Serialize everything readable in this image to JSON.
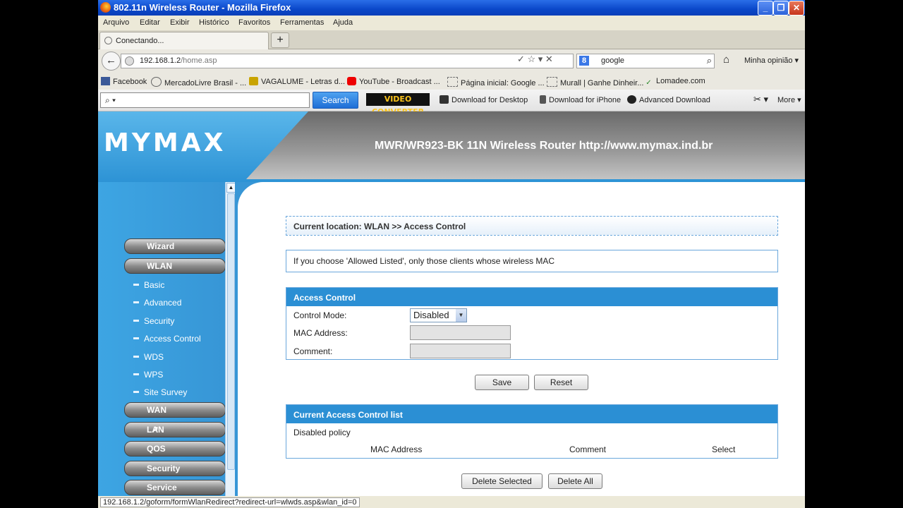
{
  "window": {
    "title": "802.11n Wireless Router - Mozilla Firefox",
    "min": "_",
    "max": "❐",
    "close": "✕"
  },
  "menubar": [
    "Arquivo",
    "Editar",
    "Exibir",
    "Histórico",
    "Favoritos",
    "Ferramentas",
    "Ajuda"
  ],
  "tabs": [
    {
      "label": "Conectando..."
    }
  ],
  "newtab": "+",
  "nav": {
    "back": "←",
    "url_host": "192.168.1.2",
    "url_path": "/home.asp",
    "search_engine": "8",
    "search_value": "google",
    "home": "⌂",
    "opinion": "Minha opinião ▾",
    "url_icons": "✓ ☆ ▾ ✕"
  },
  "bookmarks": [
    "Facebook",
    "MercadoLivre Brasil - ...",
    "VAGALUME - Letras d...",
    "YouTube - Broadcast ...",
    "Página inicial: Google ...",
    "Murall | Ganhe Dinheir...",
    "Lomadee.com"
  ],
  "search_toolbar": {
    "placeholder": "⌕ ▾",
    "search_button": "Search",
    "vdc": "VIDEO CONVERTER",
    "items": [
      "Download for Desktop",
      "Download for iPhone",
      "Advanced Download"
    ],
    "more": "More ▾"
  },
  "banner": {
    "logo": "MYMAX",
    "model": "MWR/WR923-BK 11N Wireless Router http://www.mymax.ind.br"
  },
  "sidebar": {
    "top": [
      "Wizard",
      "WLAN"
    ],
    "sub": [
      "Basic",
      "Advanced",
      "Security",
      "Access Control",
      "WDS",
      "WPS",
      "Site Survey"
    ],
    "bottom": [
      "WAN",
      "LAN",
      "QOS",
      "Security",
      "Service"
    ]
  },
  "content": {
    "location": "Current location: WLAN >> Access Control",
    "info": "If you choose 'Allowed Listed', only those clients whose wireless MAC",
    "access_title": "Access Control",
    "control_mode_label": "Control Mode:",
    "control_mode_value": "Disabled",
    "mac_label": "MAC Address:",
    "comment_label": "Comment:",
    "save": "Save",
    "reset": "Reset",
    "list_title": "Current Access Control list",
    "policy": "Disabled policy",
    "col_mac": "MAC Address",
    "col_comment": "Comment",
    "col_select": "Select",
    "delete_selected": "Delete Selected",
    "delete_all": "Delete All"
  },
  "status": "192.168.1.2/goform/formWlanRedirect?redirect-url=wlwds.asp&wlan_id=0",
  "colors": {
    "header_blue": "#2b8fd4",
    "sidebar_blue": "#3796d6",
    "title_bar": "#0a47c9"
  }
}
